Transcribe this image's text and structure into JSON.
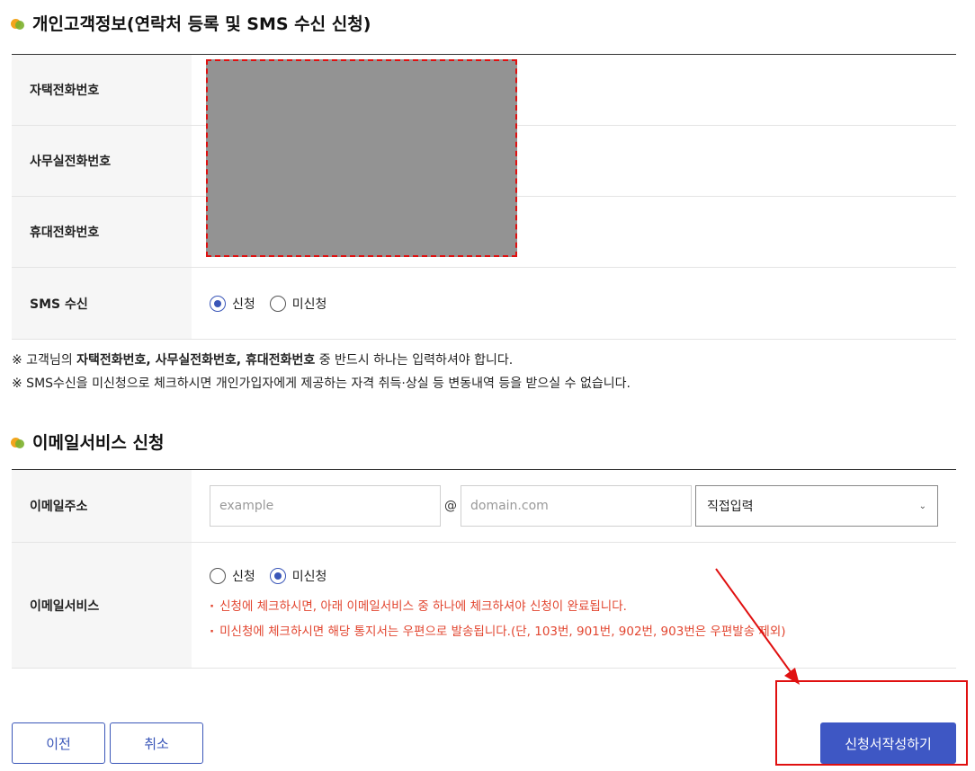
{
  "contact_section": {
    "title": "개인고객정보(연락처 등록 및 SMS 수신 신청)",
    "rows": [
      {
        "label": "자택전화번호"
      },
      {
        "label": "사무실전화번호"
      },
      {
        "label": "휴대전화번호"
      }
    ],
    "sms": {
      "label": "SMS 수신",
      "options": [
        "신청",
        "미신청"
      ],
      "selected": "신청"
    }
  },
  "notes": {
    "line1_prefix": "※ 고객님의 ",
    "line1_bold": "자택전화번호, 사무실전화번호, 휴대전화번호",
    "line1_suffix": " 중 반드시 하나는 입력하셔야 합니다.",
    "line2": "※ SMS수신을 미신청으로 체크하시면 개인가입자에게 제공하는 자격 취득·상실 등 변동내역 등을 받으실 수 없습니다."
  },
  "email_section": {
    "title": "이메일서비스 신청",
    "address": {
      "label": "이메일주소",
      "local_placeholder": "example",
      "at": "@",
      "domain_placeholder": "domain.com",
      "domain_select": "직접입력"
    },
    "service": {
      "label": "이메일서비스",
      "options": [
        "신청",
        "미신청"
      ],
      "selected": "미신청",
      "warning1": "신청에 체크하시면, 아래 이메일서비스 중 하나에 체크하셔야 신청이 완료됩니다.",
      "warning2": "미신청에 체크하시면 해당 통지서는 우편으로 발송됩니다.(단, 103번, 901번, 902번, 903번은 우편발송 제외)",
      "bullet": "·"
    }
  },
  "buttons": {
    "prev": "이전",
    "cancel": "취소",
    "submit": "신청서작성하기"
  },
  "colors": {
    "primary": "#3e57c4",
    "warning": "#e2452f",
    "annotation": "#e01010"
  }
}
